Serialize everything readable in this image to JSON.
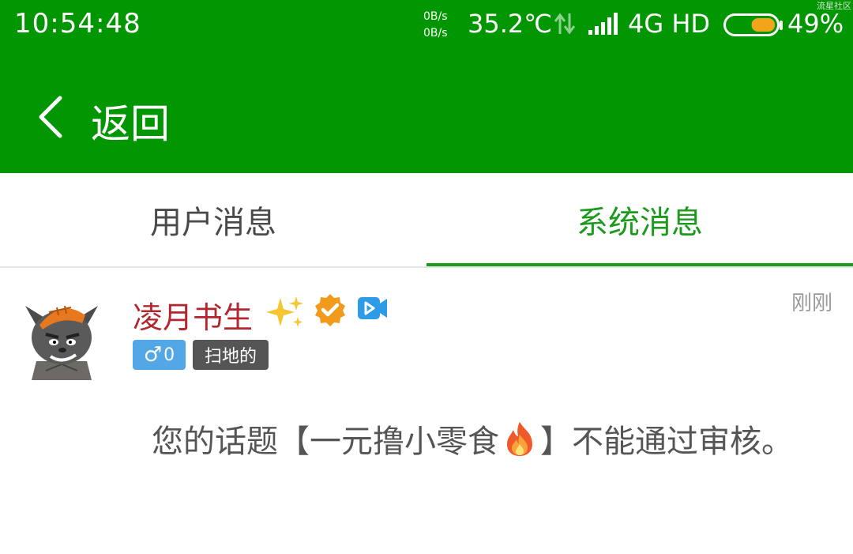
{
  "status_bar": {
    "time": "10:54:48",
    "net_up": "0B/s",
    "net_down": "0B/s",
    "temperature": "35.2℃",
    "network_type": "4G HD",
    "battery_percent": "49%",
    "battery_level": 0.49,
    "watermark": "流星社区"
  },
  "app_bar": {
    "back_label": "返回"
  },
  "tabs": {
    "user": "用户消息",
    "system": "系统消息",
    "active": "system"
  },
  "message": {
    "username": "凌月书生",
    "timestamp": "刚刚",
    "gender_count": "0",
    "gender_symbol": "♂",
    "user_title": "扫地的",
    "text_before": "您的话题【一元撸小零食",
    "text_after": "】不能通过审核。",
    "icons": [
      "sparkles-icon",
      "verified-badge-icon",
      "video-icon",
      "fire-icon"
    ]
  },
  "colors": {
    "header_green": "#039603",
    "tab_active_green": "#1b9a1b",
    "username_red": "#b3262e",
    "gender_badge_blue": "#54a7e6",
    "title_badge_gray": "#555555"
  }
}
